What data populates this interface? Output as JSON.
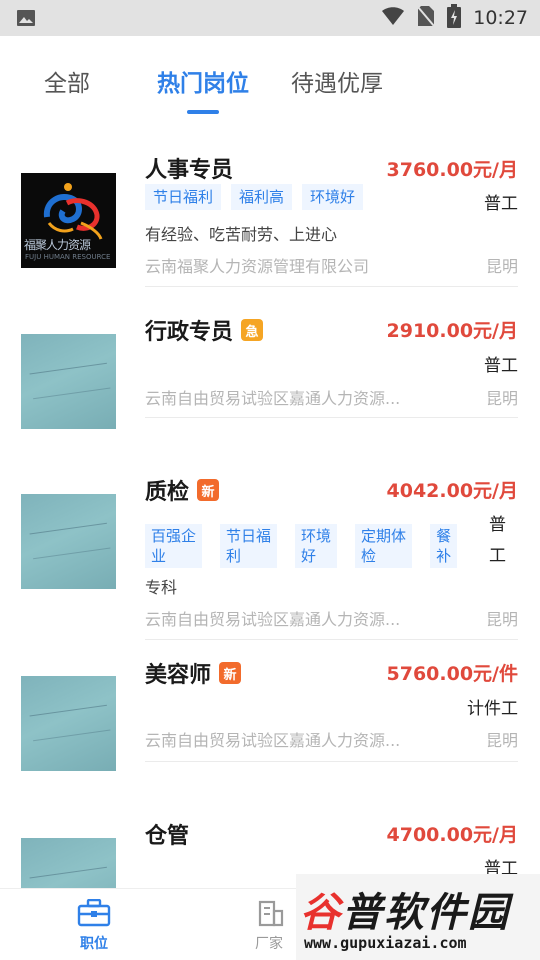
{
  "status_bar": {
    "time": "10:27",
    "icons": [
      "image-icon",
      "wifi-icon",
      "no-sim-icon",
      "battery-charging-icon"
    ]
  },
  "tabs": [
    {
      "label": "全部",
      "active": false
    },
    {
      "label": "热门岗位",
      "active": true
    },
    {
      "label": "待遇优厚",
      "active": false
    }
  ],
  "jobs": [
    {
      "title": "人事专员",
      "badge": "",
      "salary": "3760.00元/月",
      "type": "普工",
      "tags": [
        "节日福利",
        "福利高",
        "环境好"
      ],
      "description": "有经验、吃苦耐劳、上进心",
      "company": "云南福聚人力资源管理有限公司",
      "city": "昆明",
      "logo_text": "福聚人力资源",
      "logo_subtext": "FUJU HUMAN RESOURCE"
    },
    {
      "title": "行政专员",
      "badge": "急",
      "salary": "2910.00元/月",
      "type": "普工",
      "tags": [],
      "description": "",
      "company": "云南自由贸易试验区嘉通人力资源...",
      "city": "昆明"
    },
    {
      "title": "质检",
      "badge": "新",
      "salary": "4042.00元/月",
      "type_lines": [
        "普",
        "工"
      ],
      "tags_wrapped": [
        [
          "百强企",
          "业"
        ],
        [
          "节日福",
          "利"
        ],
        [
          "环境",
          "好"
        ],
        [
          "定期体",
          "检"
        ],
        [
          "餐",
          "补"
        ]
      ],
      "description": "专科",
      "company": "云南自由贸易试验区嘉通人力资源...",
      "city": "昆明"
    },
    {
      "title": "美容师",
      "badge": "新",
      "salary": "5760.00元/件",
      "type": "计件工",
      "tags": [],
      "description": "",
      "company": "云南自由贸易试验区嘉通人力资源...",
      "city": "昆明"
    },
    {
      "title": "仓管",
      "badge": "",
      "salary": "4700.00元/月",
      "type": "普工",
      "tags": [],
      "description": "",
      "company": "",
      "city": ""
    }
  ],
  "bottom_nav": [
    {
      "label": "职位",
      "icon": "briefcase-icon",
      "active": true
    },
    {
      "label": "厂家",
      "icon": "building-icon",
      "active": false
    }
  ],
  "watermark": {
    "title_first": "谷",
    "title_rest": "普软件园",
    "url": "www.gupuxiazai.com"
  },
  "colors": {
    "accent": "#2f80e8",
    "salary": "#e0493c",
    "badge_urgent": "#f5a524",
    "badge_new": "#f26b2c",
    "tag_bg": "#eef5ff"
  }
}
